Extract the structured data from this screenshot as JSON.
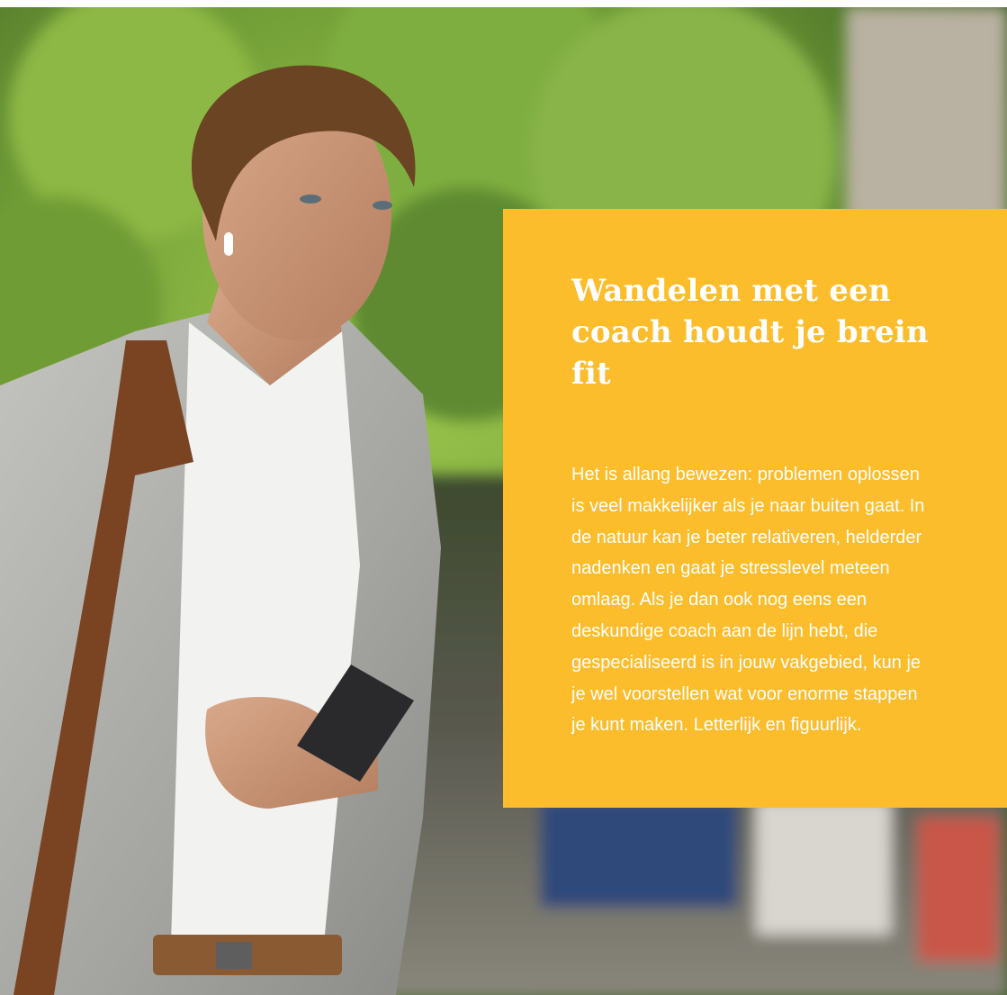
{
  "image": {
    "description_icon": "photo-man-walking-with-phone",
    "colors": {
      "card_bg": "#fbbd2b",
      "text": "#ffffff",
      "foliage": "#5f8a32",
      "jacket": "#a9a9a6",
      "strap": "#7a4322"
    }
  },
  "card": {
    "title": "Wandelen met een coach houdt je brein fit",
    "body": "Het is allang bewezen: problemen oplossen is veel makkelijker als je naar buiten gaat. In de natuur kan je beter relativeren, helderder nadenken en gaat je stresslevel meteen omlaag. Als je dan ook nog eens een deskundige coach aan de lijn hebt, die gespecialiseerd is in jouw vakgebied, kun je je wel voorstellen wat voor enorme stappen je kunt maken. Letterlijk en figuurlijk."
  }
}
